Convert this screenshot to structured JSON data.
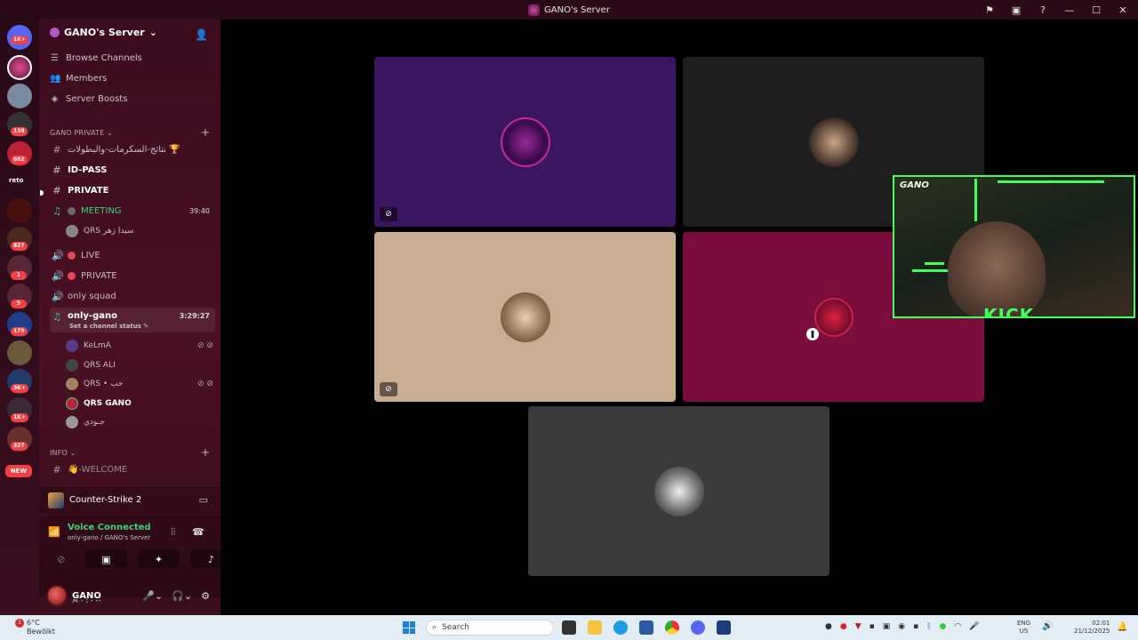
{
  "window": {
    "title": "GANO's Server",
    "controls": [
      "⚑",
      "▣",
      "?",
      "—",
      "☐",
      "✕"
    ]
  },
  "rail": {
    "badges": [
      "1K+",
      "138",
      "662",
      "827",
      "1",
      "5",
      "179",
      "3K+",
      "1K+",
      "327",
      "NEW"
    ],
    "reto_label": "reto"
  },
  "sidebar": {
    "server_name": "GANO's Server",
    "nav": [
      {
        "label": "Browse Channels",
        "icon": "browse-icon"
      },
      {
        "label": "Members",
        "icon": "members-icon"
      },
      {
        "label": "Server Boosts",
        "icon": "boost-icon"
      }
    ],
    "categories": {
      "private": "GANO PRIVATE",
      "info": "INFO"
    },
    "channels": [
      {
        "label": "نتائج-السكرمات-والبطولات 🏆"
      },
      {
        "label": "ID-PASS"
      },
      {
        "label": "PRIVATE"
      },
      {
        "label": "MEETING",
        "timer": "39:40"
      },
      {
        "label": "LIVE"
      },
      {
        "label": "PRIVATE"
      },
      {
        "label": "only squad"
      },
      {
        "label": "only-gano",
        "timer": "3:29:27",
        "status": "Set a channel status ✎"
      },
      {
        "label": "👋-WELCOME"
      }
    ],
    "meeting_users": [
      "QRS سيدا زهر"
    ],
    "gano_users": [
      "KeLmA",
      "QRS ALI",
      "QRS • خب",
      "QRS GANO",
      "جـودي"
    ]
  },
  "activity": {
    "game": "Counter-Strike 2"
  },
  "voice": {
    "status": "Voice Connected",
    "channel": "only-gano / GANO's Server"
  },
  "user": {
    "name": "GANO",
    "status_line": "🎮 • 1 • ••"
  },
  "overlay": {
    "streamer": "GANO",
    "platform": "KICK"
  },
  "taskbar": {
    "temp": "6°C",
    "weather": "Bewölkt",
    "weather_badge": "1",
    "search_placeholder": "Search",
    "lang_top": "ENG",
    "lang_bottom": "US",
    "time": "02:01",
    "date": "21/12/2025"
  },
  "colors": {
    "accent_green": "#40ff5a",
    "voice_green": "#3fd07a",
    "tile_purple": "#3a1560",
    "tile_dark": "#1e1e1e",
    "tile_beige": "#c8ad92",
    "tile_magenta": "#7a0d3c",
    "tile_gray": "#3a3a3a"
  }
}
